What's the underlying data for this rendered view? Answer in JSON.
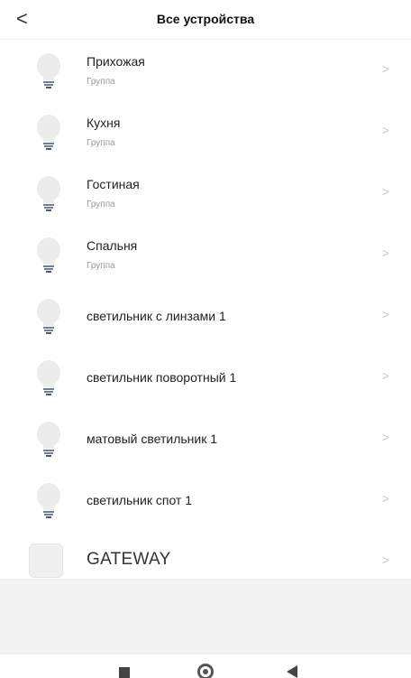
{
  "header": {
    "back_label": "<",
    "title": "Все устройства"
  },
  "items": [
    {
      "name": "Прихожая",
      "sub": "Группа",
      "icon": "bulb-icon"
    },
    {
      "name": "Кухня",
      "sub": "Группа",
      "icon": "bulb-icon"
    },
    {
      "name": "Гостиная",
      "sub": "Группа",
      "icon": "bulb-icon"
    },
    {
      "name": "Спальня",
      "sub": "Группа",
      "icon": "bulb-icon"
    },
    {
      "name": "светильник с линзами 1",
      "icon": "bulb-icon"
    },
    {
      "name": "светильник поворотный 1",
      "icon": "bulb-icon"
    },
    {
      "name": "матовый светильник 1",
      "icon": "bulb-icon"
    },
    {
      "name": "светильник спот 1",
      "icon": "bulb-icon"
    }
  ],
  "gateway": {
    "name": "GATEWAY",
    "icon": "gateway-icon"
  },
  "chevron": ">",
  "colors": {
    "text": "#1f1f1f",
    "subtext": "#9a9a9a",
    "chevron": "#c8c8c8",
    "footer": "#f2f2f2"
  }
}
